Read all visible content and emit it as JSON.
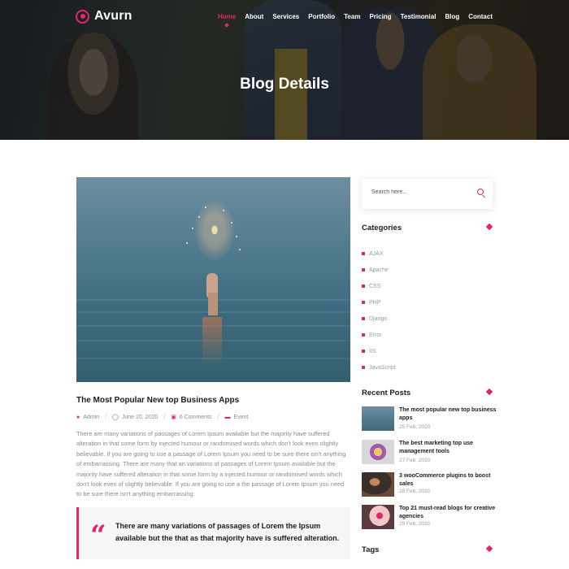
{
  "header": {
    "brand": "Avurn",
    "nav": [
      "Home",
      "About",
      "Services",
      "Portfolio",
      "Team",
      "Pricing",
      "Testimonial",
      "Blog",
      "Contact"
    ],
    "active_nav": "Home",
    "page_title": "Blog Details"
  },
  "post": {
    "title": "The Most Popular New top Business Apps",
    "author": "Admin",
    "date": "June 20, 2020",
    "comments": "6 Comments",
    "category": "Event",
    "body": "There are many variations of passages of Lorem Ipsum available but the majority have suffered alteration in that some form by injected humour or randomised words which don't look even slightly believable. If you are going to use a passage of Lorem Ipsum you need to be sure there isn't anything of embarrassing. There are many that an variations of passages of Lorem Ipsum available but the majority have suffered alteration in that some form by a injected humour or randomised words which don't look even of slightly believable. If you are going to use a the passage of Lorem Ipsum you need to be sure there isn't anything embarrassing.",
    "quote": "There are many variations of passages of Lorem the Ipsum available but the that as that majority have is suffered alteration."
  },
  "sidebar": {
    "search_placeholder": "Search here...",
    "categories_heading": "Categories",
    "categories": [
      "AJAX",
      "Apache",
      "CSS",
      "PHP",
      "Django",
      "Error",
      "IIS",
      "JavaScript"
    ],
    "recent_heading": "Recent Posts",
    "recent_posts": [
      {
        "title": "The most popular new top business apps",
        "date": "25 Feb, 2020"
      },
      {
        "title": "The best marketing top use management tools",
        "date": "27 Feb, 2020"
      },
      {
        "title": "3 wooCommerce plugins to boost sales",
        "date": "28 Feb, 2020"
      },
      {
        "title": "Top 21 must-read blogs for creative agencies",
        "date": "29 Feb, 2020"
      }
    ],
    "tags_heading": "Tags"
  },
  "colors": {
    "accent": "#e6246e",
    "heading": "#1c1c1c",
    "muted": "#8a8a8a"
  },
  "icons": [
    "logo-icon",
    "user-icon",
    "clock-icon",
    "comment-icon",
    "folder-icon",
    "quote-icon",
    "search-icon",
    "diamond-icon"
  ]
}
